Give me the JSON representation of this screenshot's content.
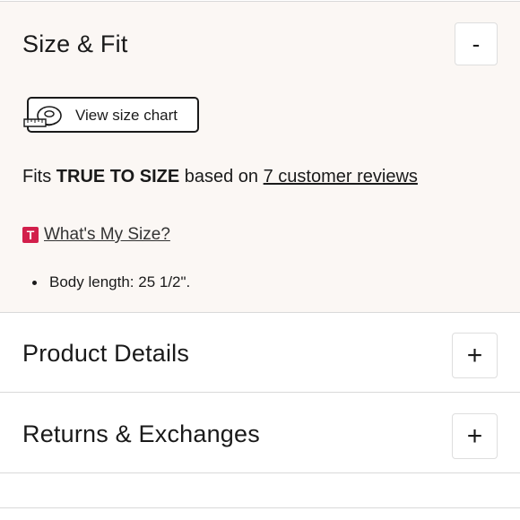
{
  "size_fit": {
    "title": "Size & Fit",
    "toggle": "-",
    "size_chart_label": "View size chart",
    "fit_prefix": "Fits ",
    "fit_bold": "TRUE TO SIZE",
    "fit_middle": " based on ",
    "fit_link": "7 customer reviews",
    "badge_letter": "T",
    "whats_my_size": "What's My Size?",
    "bullets": [
      "Body length: 25 1/2\"."
    ]
  },
  "product_details": {
    "title": "Product Details",
    "toggle": "+"
  },
  "returns": {
    "title": "Returns & Exchanges",
    "toggle": "+"
  },
  "colors": {
    "panel_bg": "#fbf7f4",
    "badge": "#d21f4b",
    "divider": "#d9d9d9"
  },
  "icons": {
    "size_chart": "measuring-tape-icon"
  }
}
